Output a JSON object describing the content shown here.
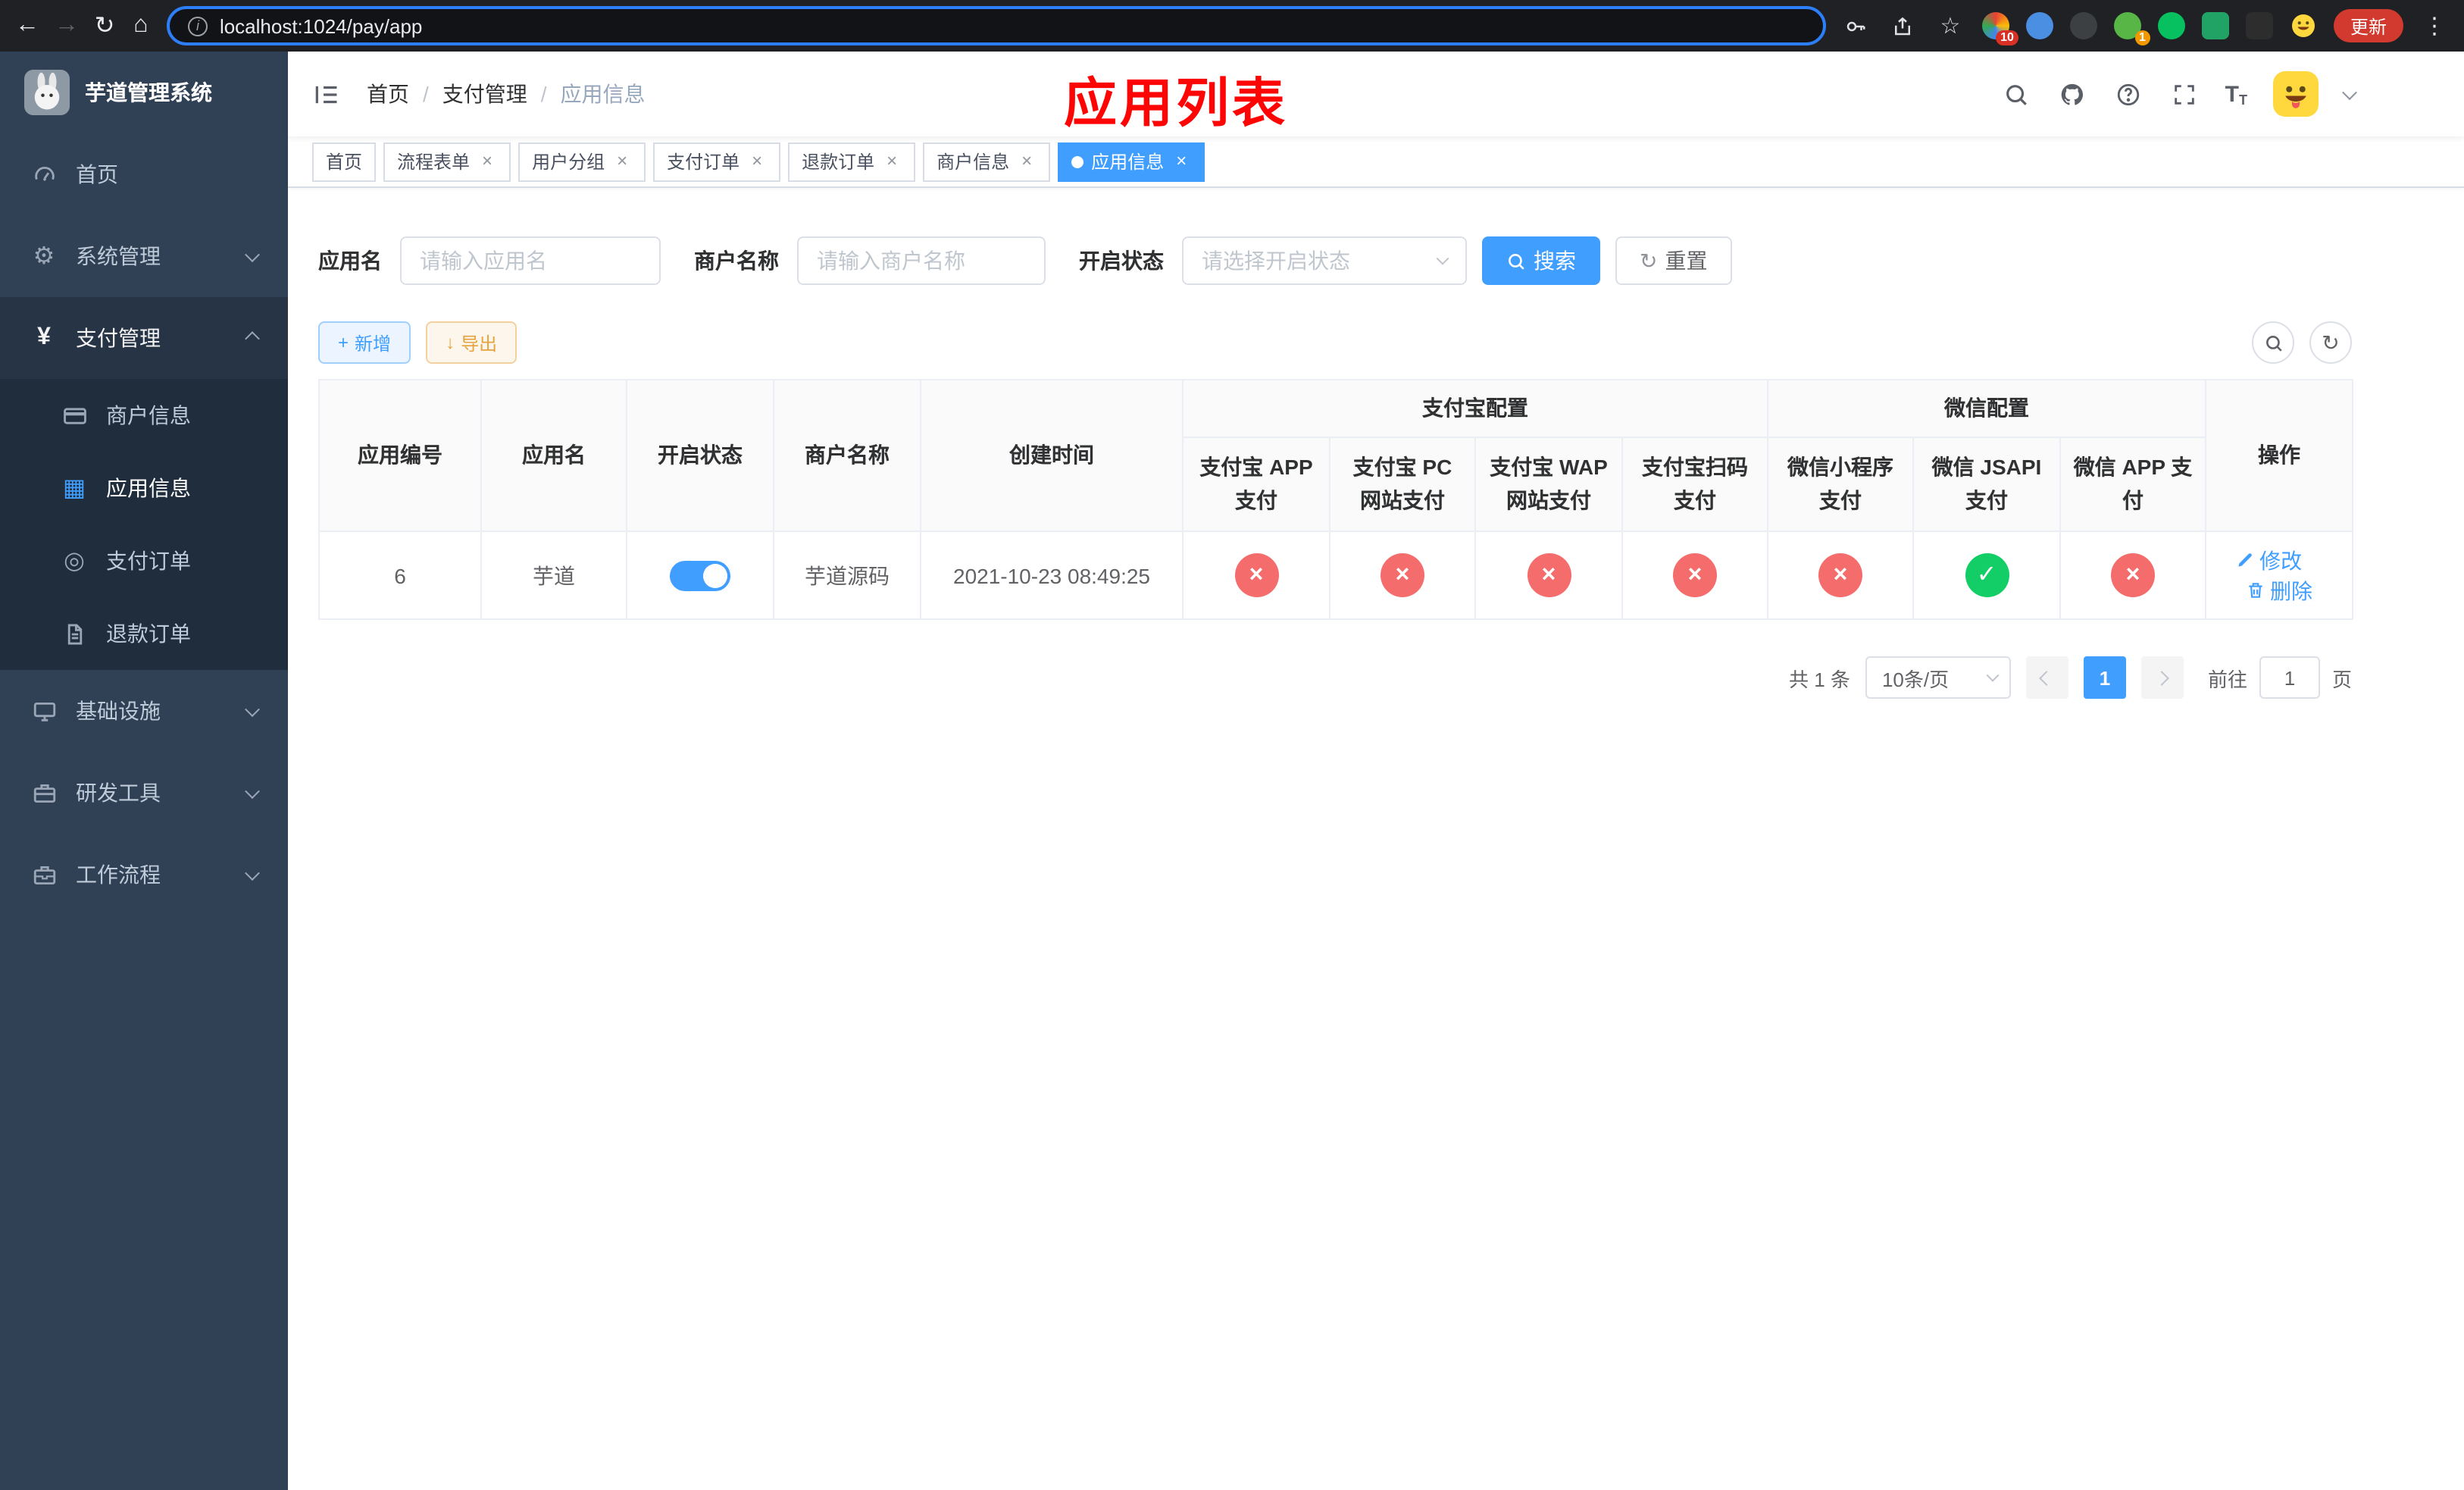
{
  "browser": {
    "url": "localhost:1024/pay/app",
    "update_button": "更新",
    "ext_badge_1": "10",
    "ext_badge_2": "1"
  },
  "icons": {
    "back": "←",
    "forward": "→",
    "reload": "↻",
    "home": "⌂",
    "star": "☆",
    "menu_dots": "⋮",
    "info": "i",
    "gear": "⚙",
    "yen": "¥",
    "grid": "▦",
    "target": "◎",
    "plus": "+",
    "download": "↓",
    "refresh": "↻",
    "close": "×",
    "check": "✓",
    "cross": "×"
  },
  "colors": {
    "primary": "#409eff",
    "danger": "#f56c6c",
    "success": "#13ce66",
    "sidebar": "#304156"
  },
  "sidebar": {
    "title": "芋道管理系统",
    "items": [
      {
        "label": "首页"
      },
      {
        "label": "系统管理"
      },
      {
        "label": "支付管理"
      },
      {
        "label": "商户信息"
      },
      {
        "label": "应用信息"
      },
      {
        "label": "支付订单"
      },
      {
        "label": "退款订单"
      },
      {
        "label": "基础设施"
      },
      {
        "label": "研发工具"
      },
      {
        "label": "工作流程"
      }
    ]
  },
  "header": {
    "breadcrumb": [
      "首页",
      "支付管理",
      "应用信息"
    ],
    "separator": "/",
    "annotation": "应用列表"
  },
  "tabs": [
    {
      "label": "首页"
    },
    {
      "label": "流程表单"
    },
    {
      "label": "用户分组"
    },
    {
      "label": "支付订单"
    },
    {
      "label": "退款订单"
    },
    {
      "label": "商户信息"
    },
    {
      "label": "应用信息"
    }
  ],
  "filters": {
    "app_name": {
      "label": "应用名",
      "placeholder": "请输入应用名"
    },
    "merchant": {
      "label": "商户名称",
      "placeholder": "请输入商户名称"
    },
    "status": {
      "label": "开启状态",
      "placeholder": "请选择开启状态"
    },
    "search": "搜索",
    "reset": "重置"
  },
  "toolbar": {
    "add": "新增",
    "export": "导出"
  },
  "table": {
    "groups": {
      "alipay": "支付宝配置",
      "wechat": "微信配置"
    },
    "columns": {
      "id": "应用编号",
      "name": "应用名",
      "status": "开启状态",
      "merchant": "商户名称",
      "created": "创建时间",
      "alipay_app": "支付宝 APP 支付",
      "alipay_pc": "支付宝 PC 网站支付",
      "alipay_wap": "支付宝 WAP 网站支付",
      "alipay_qr": "支付宝扫码支付",
      "wx_mini": "微信小程序支付",
      "wx_jsapi": "微信 JSAPI 支付",
      "wx_app": "微信 APP 支付",
      "op": "操作"
    },
    "row": {
      "id": "6",
      "name": "芋道",
      "enabled": "on",
      "merchant": "芋道源码",
      "created": "2021-10-23 08:49:25",
      "alipay_app": "no",
      "alipay_pc": "no",
      "alipay_wap": "no",
      "alipay_qr": "no",
      "wx_mini": "no",
      "wx_jsapi": "yes",
      "wx_app": "no",
      "edit": "修改",
      "delete": "删除"
    }
  },
  "pagination": {
    "total": "共 1 条",
    "page_size": "10条/页",
    "current_page": "1",
    "goto_prefix": "前往",
    "goto_value": "1",
    "goto_suffix": "页"
  }
}
